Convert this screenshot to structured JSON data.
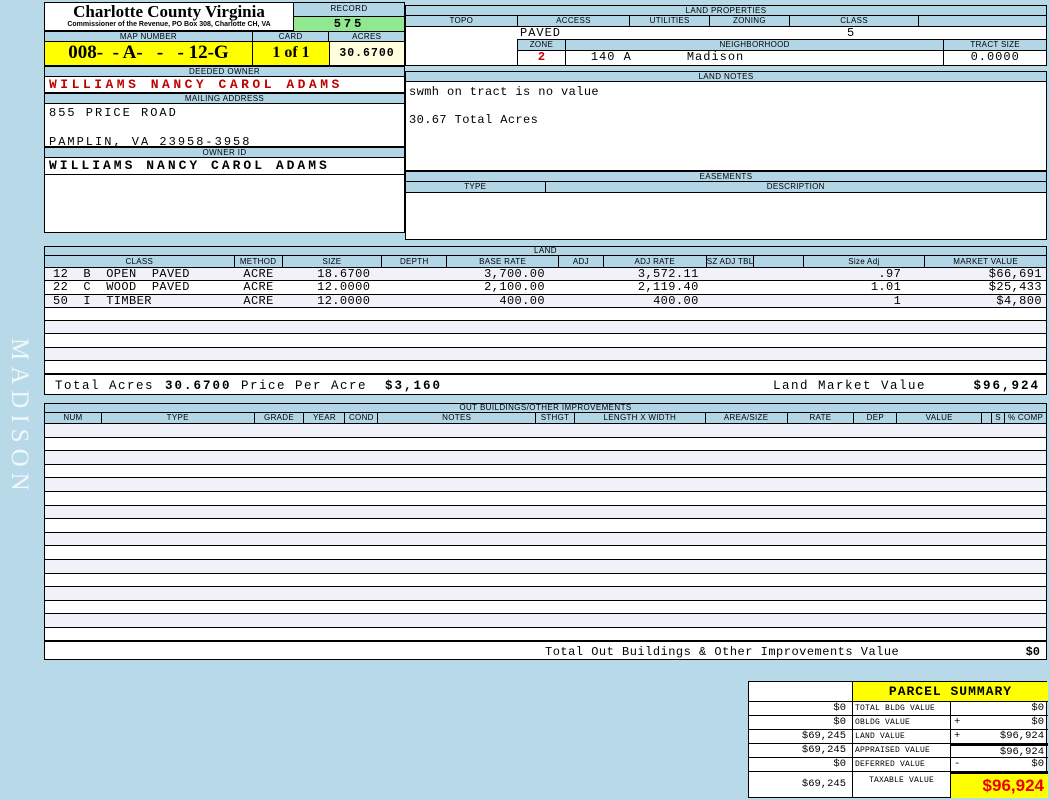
{
  "page": {
    "side_label": "MADISON"
  },
  "colors": {
    "panel_blue": "#b3d6e6",
    "highlight_yellow": "#ffff00",
    "record_green": "#90e890",
    "acres_ivory": "#ffffe0",
    "alert_red": "#c00000",
    "big_value_red": "#ee0000"
  },
  "header": {
    "county_title": "Charlotte County Virginia",
    "commissioner_line": "Commissioner of the Revenue, PO Box 308, Charlotte CH, VA",
    "record_label": "RECORD",
    "record_value": "575",
    "map_number_label": "MAP NUMBER",
    "map_number_value": "008-  - A-   -   - 12-G",
    "card_label": "CARD",
    "card_value": "1 of 1",
    "acres_label": "ACRES",
    "acres_value": "30.6700"
  },
  "owner": {
    "deeded_owner_label": "DEEDED OWNER",
    "deeded_owner": "WILLIAMS NANCY CAROL ADAMS",
    "mailing_address_label": "MAILING ADDRESS",
    "address_line1": "855 PRICE ROAD",
    "address_line2": "PAMPLIN, VA 23958-3958",
    "owner_id_label": "OWNER ID",
    "owner_id": "WILLIAMS NANCY CAROL ADAMS"
  },
  "land_properties": {
    "title": "LAND PROPERTIES",
    "topo_label": "TOPO",
    "access_label": "ACCESS",
    "utilities_label": "UTILITIES",
    "zoning_label": "ZONING",
    "class_label": "CLASS",
    "access_value": "PAVED",
    "class_value": "5",
    "zone_label": "ZONE",
    "neighborhood_label": "NEIGHBORHOOD",
    "tract_size_label": "TRACT SIZE",
    "zone_value": "2",
    "neighborhood_code": "140 A",
    "neighborhood_name": "Madison",
    "tract_size_value": "0.0000"
  },
  "land_notes": {
    "title": "LAND NOTES",
    "line1": "swmh on tract is no value",
    "line2": "30.67 Total Acres"
  },
  "easements": {
    "title": "EASEMENTS",
    "type_label": "TYPE",
    "description_label": "DESCRIPTION"
  },
  "land": {
    "title": "LAND",
    "columns": [
      "CLASS",
      "METHOD",
      "SIZE",
      "DEPTH",
      "BASE RATE",
      "ADJ",
      "ADJ RATE",
      "SZ ADJ TBL",
      "",
      "Size Adj",
      "MARKET VALUE"
    ],
    "rows": [
      {
        "class": "12  B  OPEN  PAVED",
        "method": "ACRE",
        "size": "18.6700",
        "depth": "",
        "base_rate": "3,700.00",
        "adj": "",
        "adj_rate": "3,572.11",
        "sz_adj_tbl": "",
        "size_adj": ".97",
        "market_value": "$66,691"
      },
      {
        "class": "22  C  WOOD  PAVED",
        "method": "ACRE",
        "size": "12.0000",
        "depth": "",
        "base_rate": "2,100.00",
        "adj": "",
        "adj_rate": "2,119.40",
        "sz_adj_tbl": "",
        "size_adj": "1.01",
        "market_value": "$25,433"
      },
      {
        "class": "50  I  TIMBER",
        "method": "ACRE",
        "size": "12.0000",
        "depth": "",
        "base_rate": "400.00",
        "adj": "",
        "adj_rate": "400.00",
        "sz_adj_tbl": "",
        "size_adj": "1",
        "market_value": "$4,800"
      }
    ],
    "total_acres_label": "Total Acres",
    "total_acres_value": "30.6700",
    "price_per_acre_label": "Price Per Acre",
    "price_per_acre_value": "$3,160",
    "land_market_value_label": "Land Market Value",
    "land_market_value": "$96,924"
  },
  "out_buildings": {
    "title": "OUT BUILDINGS/OTHER IMPROVEMENTS",
    "columns": [
      "NUM",
      "TYPE",
      "GRADE",
      "YEAR",
      "COND",
      "NOTES",
      "STHGT",
      "LENGTH X WIDTH",
      "AREA/SIZE",
      "RATE",
      "DEP",
      "VALUE",
      "",
      "S",
      "% COMP"
    ],
    "total_label": "Total Out Buildings & Other Improvements Value",
    "total_value": "$0"
  },
  "parcel_summary": {
    "title": "PARCEL SUMMARY",
    "rows": [
      {
        "left": "$0",
        "label": "TOTAL BLDG VALUE",
        "op": "",
        "right": "$0"
      },
      {
        "left": "$0",
        "label": "OBLDG VALUE",
        "op": "+",
        "right": "$0"
      },
      {
        "left": "$69,245",
        "label": "LAND VALUE",
        "op": "+",
        "right": "$96,924"
      },
      {
        "left": "$69,245",
        "label": "APPRAISED VALUE",
        "op": "",
        "right": "$96,924"
      },
      {
        "left": "$0",
        "label": "DEFERRED VALUE",
        "op": "-",
        "right": "$0"
      }
    ],
    "taxable": {
      "left": "$69,245",
      "label": "TAXABLE VALUE",
      "value": "$96,924"
    }
  }
}
